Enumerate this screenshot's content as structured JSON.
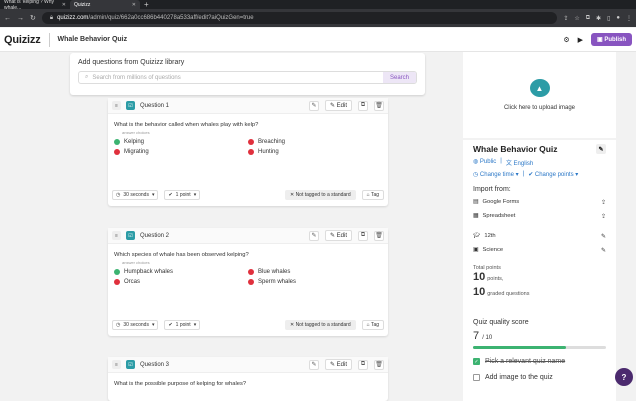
{
  "browser": {
    "tabs": [
      {
        "label": "What is 'kelping'? Why whale...",
        "active": false
      },
      {
        "label": "Quizizz",
        "active": true
      }
    ],
    "url_host": "quizizz.com",
    "url_path": "/admin/quiz/662a0cc686b440278a533aff/edit?aiQuizGen=true"
  },
  "header": {
    "logo": "Quizizz",
    "quiz_title": "Whale Behavior Quiz",
    "publish_label": "Publish"
  },
  "add_questions": {
    "title": "Add questions from Quizizz library",
    "placeholder": "Search from millions of questions",
    "search_button": "Search"
  },
  "questions": [
    {
      "label": "Question 1",
      "text": "What is the behavior called when whales play with kelp?",
      "answer_choices_label": "answer choices",
      "answers": [
        {
          "text": "Kelping",
          "correct": true
        },
        {
          "text": "Breaching",
          "correct": false
        },
        {
          "text": "Migrating",
          "correct": false
        },
        {
          "text": "Hunting",
          "correct": false
        }
      ],
      "time": "30 seconds",
      "points": "1 point",
      "standard": "Not tagged to a standard",
      "tag": "Tag",
      "edit": "Edit"
    },
    {
      "label": "Question 2",
      "text": "Which species of whale has been observed kelping?",
      "answer_choices_label": "answer choices",
      "answers": [
        {
          "text": "Humpback whales",
          "correct": true
        },
        {
          "text": "Blue whales",
          "correct": false
        },
        {
          "text": "Orcas",
          "correct": false
        },
        {
          "text": "Sperm whales",
          "correct": false
        }
      ],
      "time": "30 seconds",
      "points": "1 point",
      "standard": "Not tagged to a standard",
      "tag": "Tag",
      "edit": "Edit"
    },
    {
      "label": "Question 3",
      "text": "What is the possible purpose of kelping for whales?",
      "edit": "Edit"
    }
  ],
  "sidebar": {
    "upload_text": "Click here to upload image",
    "title": "Whale Behavior Quiz",
    "visibility": "Public",
    "language": "English",
    "change_time": "Change time",
    "change_points": "Change points",
    "import_from": "Import from:",
    "imports": [
      "Google Forms",
      "Spreadsheet"
    ],
    "grade": "12th",
    "subject": "Science",
    "total_points_label": "Total points",
    "points_value": "10",
    "points_unit": "points,",
    "graded_value": "10",
    "graded_unit": "graded questions",
    "quality_title": "Quiz quality score",
    "quality_score": "7",
    "quality_max": "/ 10",
    "quality_fraction": 0.7,
    "checklist": [
      {
        "text": "Pick a relevant quiz name",
        "done": true
      },
      {
        "text": "Add image to the quiz",
        "done": false
      }
    ]
  },
  "help": "?"
}
